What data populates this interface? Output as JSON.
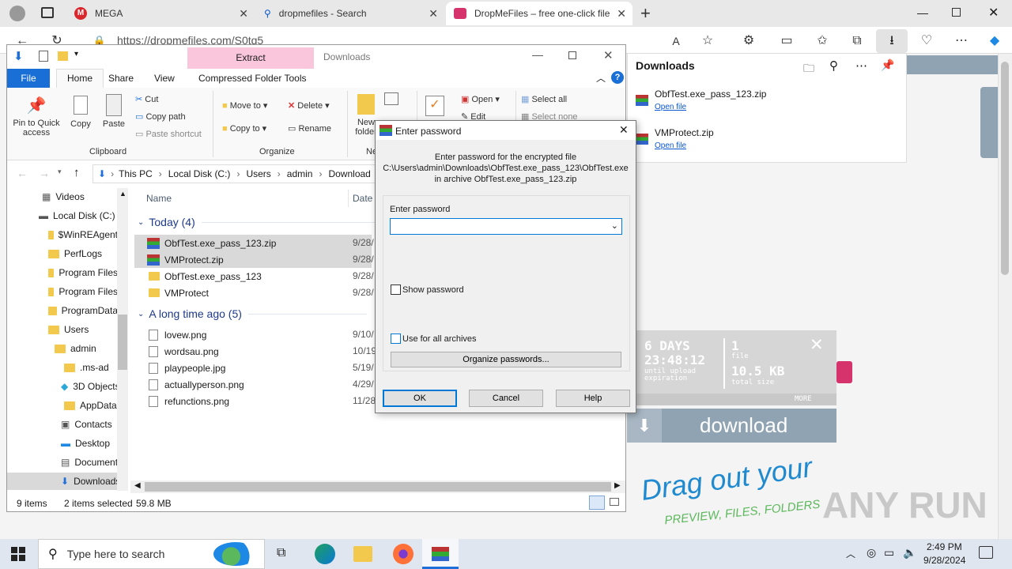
{
  "browser": {
    "tabs": [
      {
        "label": "MEGA"
      },
      {
        "label": "dropmefiles - Search"
      },
      {
        "label": "DropMeFiles – free one-click file"
      }
    ],
    "url": "https://dropmefiles.com/S0tq5"
  },
  "downloads_panel": {
    "title": "Downloads",
    "items": [
      {
        "name": "ObfTest.exe_pass_123.zip",
        "action": "Open file"
      },
      {
        "name": "VMProtect.zip",
        "action": "Open file"
      }
    ]
  },
  "widget": {
    "days": "6 DAYS",
    "time": "23:48:12",
    "until1": "until upload",
    "until2": "expiration",
    "count": "1",
    "count_label": "file",
    "size": "10.5 KB",
    "size_label": "total size",
    "more": "MORE",
    "download": "download",
    "drag1": "Drag out your",
    "drag2": "PREVIEW, FILES, FOLDERS",
    "watermark": "ANY RUN"
  },
  "explorer": {
    "context_tab": "Extract",
    "title": "Downloads",
    "menu_tabs": [
      "File",
      "Home",
      "Share",
      "View",
      "Compressed Folder Tools"
    ],
    "ribbon": {
      "pin": "Pin to Quick access",
      "copy": "Copy",
      "paste": "Paste",
      "cut": "Cut",
      "copy_path": "Copy path",
      "paste_shortcut": "Paste shortcut",
      "clipboard": "Clipboard",
      "move_to": "Move to",
      "copy_to": "Copy to",
      "delete": "Delete",
      "rename": "Rename",
      "organize": "Organize",
      "new_folder": "New folder",
      "new_group": "Ne",
      "open": "Open",
      "edit": "Edit",
      "select_all": "Select all",
      "select_none": "Select none"
    },
    "breadcrumb": [
      "This PC",
      "Local Disk (C:)",
      "Users",
      "admin",
      "Download"
    ],
    "tree": [
      "Videos",
      "Local Disk (C:)",
      "$WinREAgent",
      "PerfLogs",
      "Program Files",
      "Program Files",
      "ProgramData",
      "Users",
      "admin",
      ".ms-ad",
      "3D Objects",
      "AppData",
      "Contacts",
      "Desktop",
      "Documents",
      "Downloads"
    ],
    "columns": {
      "name": "Name",
      "date": "Date"
    },
    "group_today": "Today (4)",
    "group_old": "A long time ago (5)",
    "files_today": [
      {
        "name": "ObfTest.exe_pass_123.zip",
        "date": "9/28/",
        "type": "zip",
        "selected": true
      },
      {
        "name": "VMProtect.zip",
        "date": "9/28/",
        "type": "zip",
        "selected": true
      },
      {
        "name": "ObfTest.exe_pass_123",
        "date": "9/28/",
        "type": "folder",
        "selected": false
      },
      {
        "name": "VMProtect",
        "date": "9/28/",
        "type": "folder",
        "selected": false
      }
    ],
    "files_old": [
      {
        "name": "lovew.png",
        "date": "9/10/"
      },
      {
        "name": "wordsau.png",
        "date": "10/19"
      },
      {
        "name": "playpeople.jpg",
        "date": "5/19/"
      },
      {
        "name": "actuallyperson.png",
        "date": "4/29/"
      },
      {
        "name": "refunctions.png",
        "date": "11/28"
      }
    ],
    "status": {
      "count": "9 items",
      "selected": "2 items selected",
      "size": "59.8 MB"
    }
  },
  "dialog": {
    "title": "Enter password",
    "line1": "Enter password for the encrypted file",
    "line2": "C:\\Users\\admin\\Downloads\\ObfTest.exe_pass_123\\ObfTest.exe",
    "line3": "in archive ObfTest.exe_pass_123.zip",
    "label": "Enter password",
    "value": "",
    "show_password": "Show password",
    "use_all": "Use for all archives",
    "organize": "Organize passwords...",
    "ok": "OK",
    "cancel": "Cancel",
    "help": "Help"
  },
  "taskbar": {
    "search_placeholder": "Type here to search",
    "time": "2:49 PM",
    "date": "9/28/2024"
  }
}
